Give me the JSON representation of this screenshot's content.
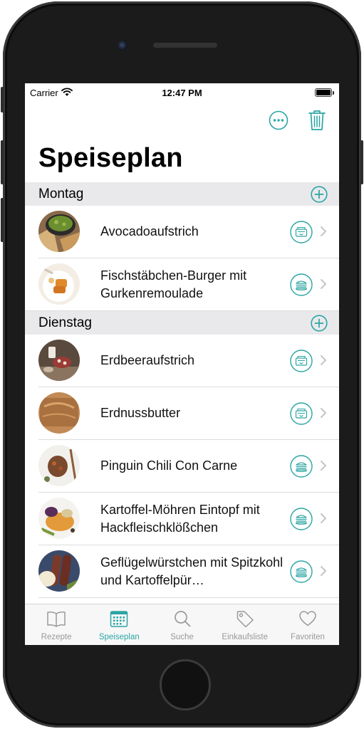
{
  "status_bar": {
    "carrier": "Carrier",
    "time": "12:47 PM"
  },
  "nav": {
    "more_icon": "ellipsis-circle-icon",
    "delete_icon": "trash-icon"
  },
  "page_title": "Speiseplan",
  "colors": {
    "accent": "#2aa5a4",
    "section_bg": "#e9e9ec",
    "tab_inactive": "#999999"
  },
  "sections": [
    {
      "title": "Montag",
      "add_icon": "plus-circle-icon",
      "items": [
        {
          "title": "Avocadoaufstrich",
          "action_icon": "lunchbox-icon"
        },
        {
          "title": "Fischstäbchen-Burger mit Gurkenremoulade",
          "action_icon": "burger-icon"
        }
      ]
    },
    {
      "title": "Dienstag",
      "add_icon": "plus-circle-icon",
      "items": [
        {
          "title": "Erdbeeraufstrich",
          "action_icon": "lunchbox-icon"
        },
        {
          "title": "Erdnussbutter",
          "action_icon": "lunchbox-icon"
        },
        {
          "title": "Pinguin Chili Con Carne",
          "action_icon": "burger-icon"
        },
        {
          "title": "Kartoffel-Möhren Eintopf mit Hackfleischklößchen",
          "action_icon": "burger-icon"
        },
        {
          "title": "Geflügelwürstchen mit Spitzkohl und Kartoffelpür…",
          "action_icon": "burger-icon"
        }
      ]
    }
  ],
  "tabs": [
    {
      "label": "Rezepte",
      "icon": "book-icon",
      "active": false
    },
    {
      "label": "Speiseplan",
      "icon": "calendar-icon",
      "active": true
    },
    {
      "label": "Suche",
      "icon": "search-icon",
      "active": false
    },
    {
      "label": "Einkaufsliste",
      "icon": "tag-icon",
      "active": false
    },
    {
      "label": "Favoriten",
      "icon": "heart-icon",
      "active": false
    }
  ]
}
